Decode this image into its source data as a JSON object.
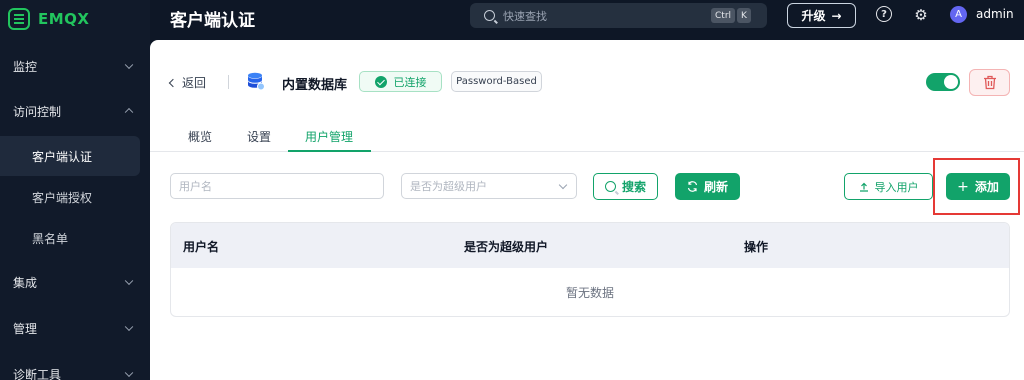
{
  "brand": {
    "name": "EMQX"
  },
  "sidebar": {
    "groups": [
      {
        "label": "监控",
        "expanded": false
      },
      {
        "label": "访问控制",
        "expanded": true
      },
      {
        "label": "集成",
        "expanded": false
      },
      {
        "label": "管理",
        "expanded": false
      },
      {
        "label": "诊断工具",
        "expanded": false
      }
    ],
    "access_control_items": [
      {
        "label": "客户端认证",
        "active": true
      },
      {
        "label": "客户端授权",
        "active": false
      },
      {
        "label": "黑名单",
        "active": false
      }
    ]
  },
  "header": {
    "title": "客户端认证",
    "search_placeholder": "快速查找",
    "shortcut_keys": [
      "Ctrl",
      "K"
    ],
    "upgrade_label": "升级",
    "upgrade_arrow": "→",
    "help_icon": "?",
    "settings_icon": "⚙",
    "avatar_letter": "A",
    "username": "admin"
  },
  "authenticator": {
    "back_label": "返回",
    "name": "内置数据库",
    "status": "已连接",
    "mechanism": "Password-Based",
    "enabled": true
  },
  "tabs": [
    {
      "label": "概览",
      "active": false
    },
    {
      "label": "设置",
      "active": false
    },
    {
      "label": "用户管理",
      "active": true
    }
  ],
  "filters": {
    "username_placeholder": "用户名",
    "superuser_placeholder": "是否为超级用户",
    "search_label": "搜索",
    "refresh_label": "刷新",
    "import_label": "导入用户",
    "add_label": "添加"
  },
  "table": {
    "columns": [
      "用户名",
      "是否为超级用户",
      "操作"
    ],
    "rows": [],
    "empty_text": "暂无数据"
  },
  "colors": {
    "accent": "#12a36a",
    "sidebar_bg": "#111a2a",
    "header_bg": "#0e1726",
    "highlight": "#e53935"
  }
}
